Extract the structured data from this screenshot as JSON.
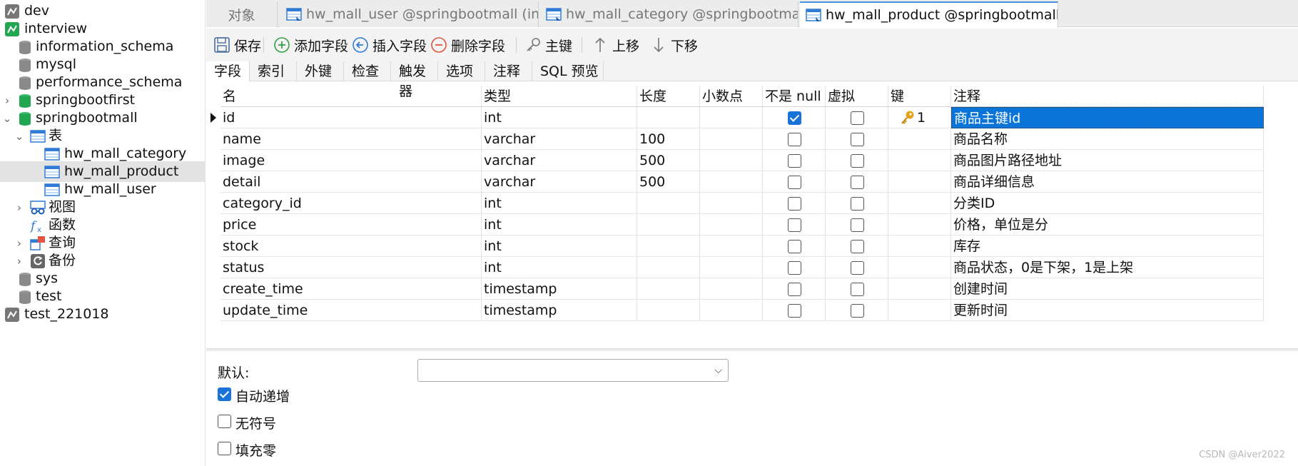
{
  "sidebar": {
    "items": [
      {
        "label": "dev"
      },
      {
        "label": "interview"
      },
      {
        "label": "information_schema"
      },
      {
        "label": "mysql"
      },
      {
        "label": "performance_schema"
      },
      {
        "label": "springbootfirst"
      },
      {
        "label": "springbootmall"
      },
      {
        "label": "表"
      },
      {
        "label": "hw_mall_category"
      },
      {
        "label": "hw_mall_product"
      },
      {
        "label": "hw_mall_user"
      },
      {
        "label": "视图"
      },
      {
        "label": "函数"
      },
      {
        "label": "查询"
      },
      {
        "label": "备份"
      },
      {
        "label": "sys"
      },
      {
        "label": "test"
      },
      {
        "label": "test_221018"
      }
    ]
  },
  "tabs": [
    {
      "label": "对象"
    },
    {
      "label": "hw_mall_user @springbootmall (int..."
    },
    {
      "label": "hw_mall_category @springbootmall..."
    },
    {
      "label": "hw_mall_product @springbootmall ..."
    }
  ],
  "toolbar": {
    "save": "保存",
    "add_field": "添加字段",
    "insert_field": "插入字段",
    "delete_field": "删除字段",
    "primary_key": "主键",
    "move_up": "上移",
    "move_down": "下移"
  },
  "subtabs": [
    "字段",
    "索引",
    "外键",
    "检查",
    "触发器",
    "选项",
    "注释",
    "SQL 预览"
  ],
  "grid": {
    "headers": [
      "名",
      "类型",
      "长度",
      "小数点",
      "不是 null",
      "虚拟",
      "键",
      "注释"
    ],
    "key_value": "1",
    "rows": [
      {
        "name": "id",
        "type": "int",
        "length": "",
        "decimals": "",
        "not_null": true,
        "virtual": false,
        "key": true,
        "comment": "商品主键id"
      },
      {
        "name": "name",
        "type": "varchar",
        "length": "100",
        "decimals": "",
        "not_null": false,
        "virtual": false,
        "key": false,
        "comment": "商品名称"
      },
      {
        "name": "image",
        "type": "varchar",
        "length": "500",
        "decimals": "",
        "not_null": false,
        "virtual": false,
        "key": false,
        "comment": "商品图片路径地址"
      },
      {
        "name": "detail",
        "type": "varchar",
        "length": "500",
        "decimals": "",
        "not_null": false,
        "virtual": false,
        "key": false,
        "comment": "商品详细信息"
      },
      {
        "name": "category_id",
        "type": "int",
        "length": "",
        "decimals": "",
        "not_null": false,
        "virtual": false,
        "key": false,
        "comment": "分类ID"
      },
      {
        "name": "price",
        "type": "int",
        "length": "",
        "decimals": "",
        "not_null": false,
        "virtual": false,
        "key": false,
        "comment": "价格，单位是分"
      },
      {
        "name": "stock",
        "type": "int",
        "length": "",
        "decimals": "",
        "not_null": false,
        "virtual": false,
        "key": false,
        "comment": "库存"
      },
      {
        "name": "status",
        "type": "int",
        "length": "",
        "decimals": "",
        "not_null": false,
        "virtual": false,
        "key": false,
        "comment": "商品状态，0是下架，1是上架"
      },
      {
        "name": "create_time",
        "type": "timestamp",
        "length": "",
        "decimals": "",
        "not_null": false,
        "virtual": false,
        "key": false,
        "comment": "创建时间"
      },
      {
        "name": "update_time",
        "type": "timestamp",
        "length": "",
        "decimals": "",
        "not_null": false,
        "virtual": false,
        "key": false,
        "comment": "更新时间"
      }
    ]
  },
  "props": {
    "default_label": "默认:",
    "default_value": "",
    "auto_increment": {
      "label": "自动递增",
      "checked": true
    },
    "unsigned": {
      "label": "无符号",
      "checked": false
    },
    "zerofill": {
      "label": "填充零",
      "checked": false
    }
  },
  "watermark": "CSDN @Aiver2022",
  "colors": {
    "accent": "#0a74d8",
    "db_green": "#22a652",
    "db_gray": "#8a8a8a",
    "selected_row": "#e3e3e3"
  }
}
